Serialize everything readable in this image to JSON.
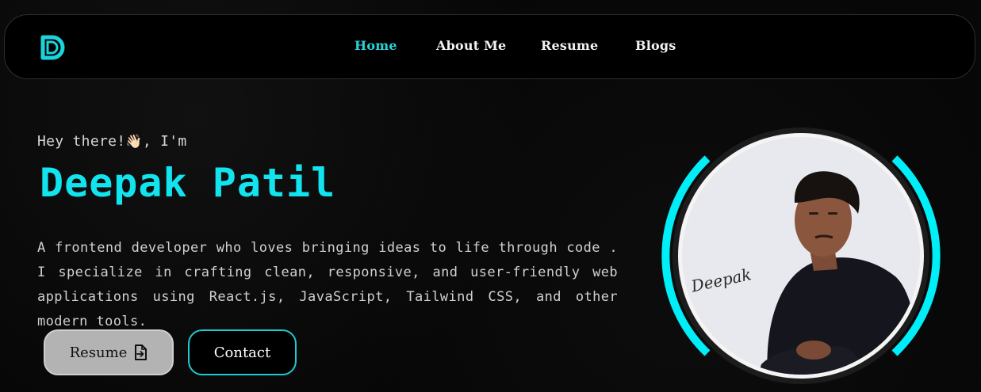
{
  "nav": {
    "logo_letter": "D",
    "links": [
      {
        "label": "Home",
        "active": true
      },
      {
        "label": "About Me",
        "active": false
      },
      {
        "label": "Resume",
        "active": false
      },
      {
        "label": "Blogs",
        "active": false
      }
    ]
  },
  "hero": {
    "greeting_before": "Hey there!",
    "greeting_emoji": "👋🏻",
    "greeting_after": ", I'm",
    "name": "Deepak Patil",
    "bio": "A frontend developer who loves bringing ideas to life through code . I specialize in crafting clean, responsive, and user-friendly web applications using React.js, JavaScript, Tailwind CSS, and other modern tools."
  },
  "buttons": {
    "resume_label": "Resume",
    "resume_icon": "file-export-icon",
    "contact_label": "Contact"
  },
  "portrait": {
    "signature": "Deepak"
  },
  "colors": {
    "accent": "#12e4ef",
    "background": "#070707",
    "resume_button_bg": "#b3b3b3"
  }
}
